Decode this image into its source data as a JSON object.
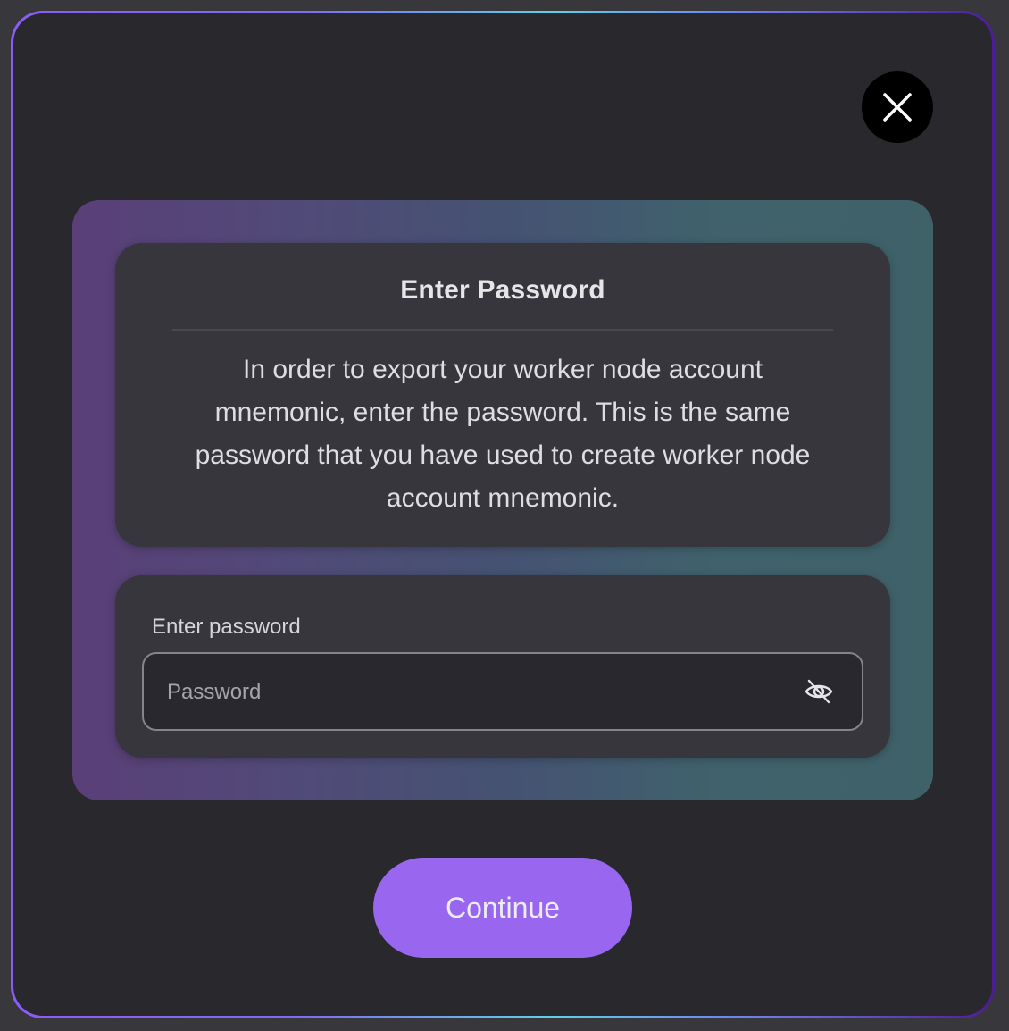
{
  "modal": {
    "title": "Enter Password",
    "description": "In order to export your worker node account mnemonic, enter the password. This is the same password that you have used to create worker node account mnemonic.",
    "close_icon": "close-icon"
  },
  "password_form": {
    "label": "Enter password",
    "placeholder": "Password",
    "value": "",
    "visibility_icon": "eye-off-icon"
  },
  "actions": {
    "continue_label": "Continue"
  },
  "colors": {
    "accent": "#9966f0",
    "background": "#29282d",
    "card": "#37363c"
  }
}
